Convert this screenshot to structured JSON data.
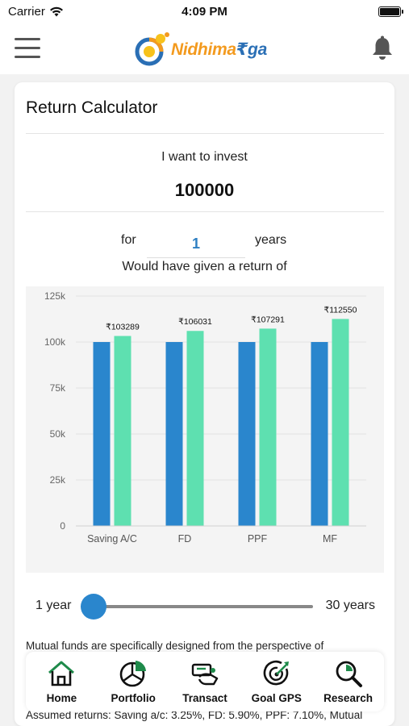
{
  "status_bar": {
    "carrier": "Carrier",
    "time": "4:09 PM"
  },
  "header": {
    "logo_part1": "Nidhima",
    "logo_part2": "₹ga"
  },
  "calculator": {
    "title": "Return Calculator",
    "invest_label": "I want to invest",
    "invest_amount": "100000",
    "for_label": "for",
    "years_value": "1",
    "years_label": "years",
    "return_label": "Would have given a return of"
  },
  "chart_data": {
    "type": "bar",
    "categories": [
      "Saving A/C",
      "FD",
      "PPF",
      "MF"
    ],
    "series": [
      {
        "values": [
          100000,
          100000,
          100000,
          100000
        ],
        "color": "#2a86cd"
      },
      {
        "values": [
          103289,
          106031,
          107291,
          112550
        ],
        "color": "#5ee0b0"
      }
    ],
    "data_labels": [
      "₹103289",
      "₹106031",
      "₹107291",
      "₹112550"
    ],
    "y_ticks": [
      "0",
      "25k",
      "50k",
      "75k",
      "100k",
      "125k"
    ],
    "ylim": [
      0,
      125000
    ],
    "grid": true
  },
  "slider": {
    "min_label": "1 year",
    "max_label": "30 years",
    "value_years": 1,
    "min_years": 1,
    "max_years": 30
  },
  "description": "Mutual funds are specifically designed from the perspective of",
  "assumed_returns": "Assumed returns: Saving a/c: 3.25%, FD: 5.90%, PPF: 7.10%, Mutual",
  "nav": {
    "home": "Home",
    "portfolio": "Portfolio",
    "transact": "Transact",
    "goal_gps": "Goal GPS",
    "research": "Research"
  },
  "colors": {
    "accent": "#2a86cd",
    "brand_orange": "#f39a1e",
    "brand_blue": "#2a6fb5",
    "nav_green": "#1e8a4a",
    "bar_return": "#5ee0b0"
  }
}
